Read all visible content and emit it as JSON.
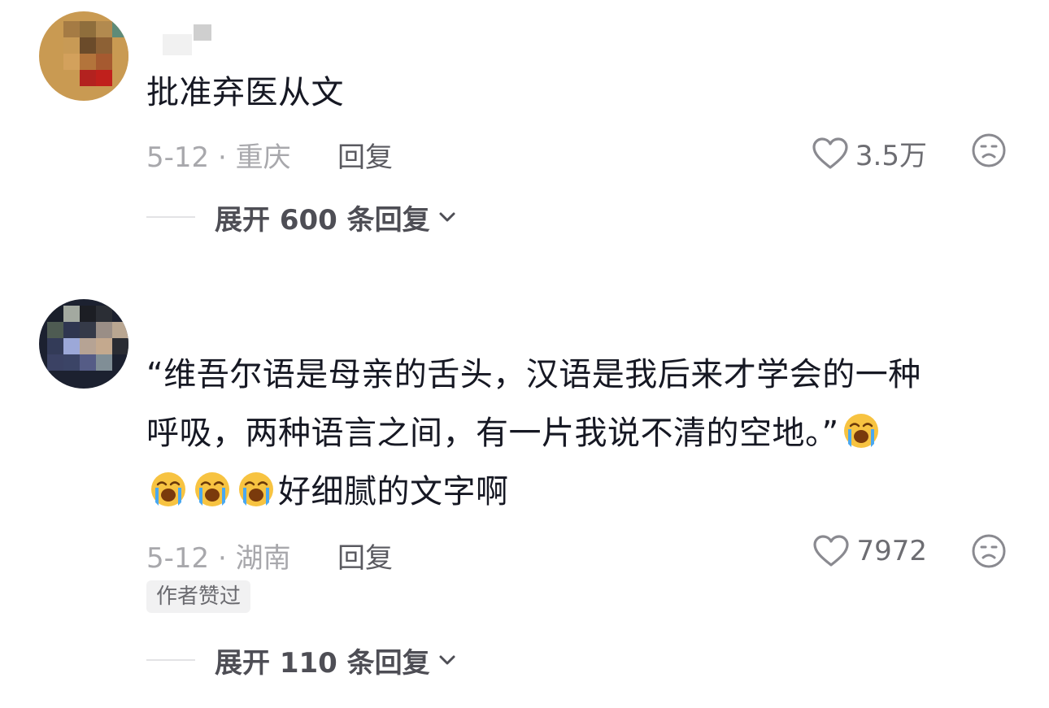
{
  "comments": [
    {
      "text": "批准弃医从文",
      "date_location": "5-12 · 重庆",
      "reply_label": "回复",
      "likes": "3.5万",
      "expand_label": "展开 600 条回复"
    },
    {
      "text_line1": "“维吾尔语是母亲的舌头，汉语是我后来才学会的一种",
      "text_line2": "呼吸，两种语言之间，有一片我说不清的空地。”",
      "text_line3": "好细腻的文字啊",
      "date_location": "5-12 · 湖南",
      "reply_label": "回复",
      "likes": "7972",
      "author_badge": "作者赞过",
      "expand_label": "展开 110 条回复"
    }
  ],
  "icons": {
    "like": "heart-outline-icon",
    "dislike": "frown-face-icon",
    "expand": "chevron-down-icon",
    "emoji": "loudly-crying-face-emoji"
  },
  "colors": {
    "text": "#161823",
    "meta": "#a8a8ac",
    "emoji_face": "#f7c341",
    "emoji_tear": "#4aa8f0"
  }
}
